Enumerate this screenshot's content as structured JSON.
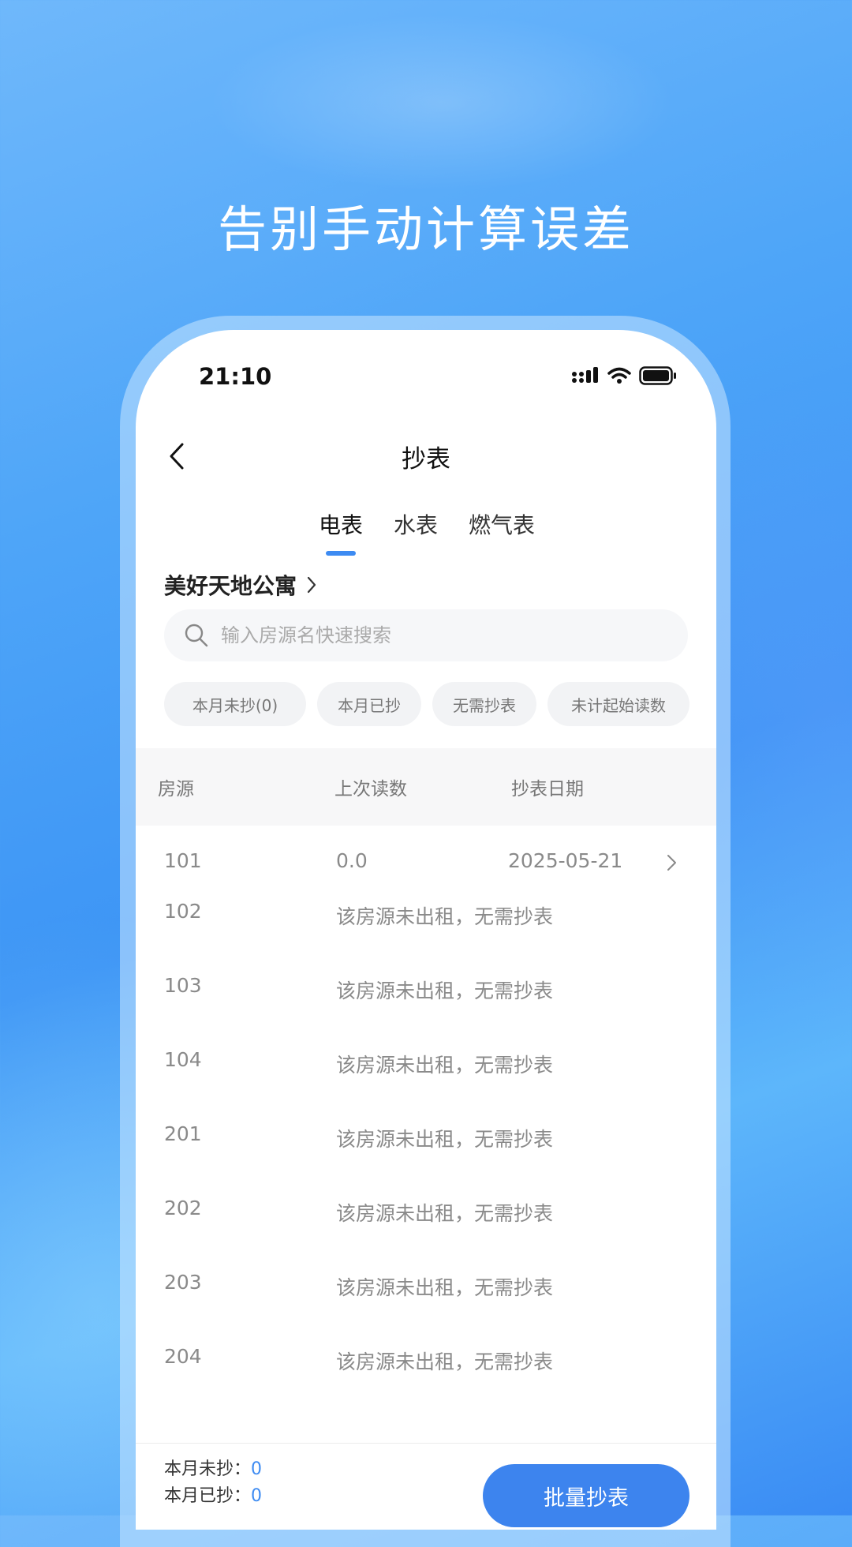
{
  "headline": "告别手动计算误差",
  "status_bar": {
    "time": "21:10"
  },
  "nav": {
    "title": "抄表"
  },
  "tabs": [
    {
      "label": "电表",
      "active": true
    },
    {
      "label": "水表",
      "active": false
    },
    {
      "label": "燃气表",
      "active": false
    }
  ],
  "property": {
    "name": "美好天地公寓"
  },
  "search": {
    "placeholder": "输入房源名快速搜索",
    "value": ""
  },
  "filters": [
    {
      "label": "本月未抄(0)"
    },
    {
      "label": "本月已抄"
    },
    {
      "label": "无需抄表"
    },
    {
      "label": "未计起始读数"
    }
  ],
  "table": {
    "headers": [
      "房源",
      "上次读数",
      "抄表日期"
    ],
    "rows": [
      {
        "room": "101",
        "last_reading": "0.0",
        "date": "2025-05-21"
      },
      {
        "room": "102",
        "note": "该房源未出租，无需抄表"
      },
      {
        "room": "103",
        "note": "该房源未出租，无需抄表"
      },
      {
        "room": "104",
        "note": "该房源未出租，无需抄表"
      },
      {
        "room": "201",
        "note": "该房源未出租，无需抄表"
      },
      {
        "room": "202",
        "note": "该房源未出租，无需抄表"
      },
      {
        "room": "203",
        "note": "该房源未出租，无需抄表"
      },
      {
        "room": "204",
        "note": "该房源未出租，无需抄表"
      }
    ]
  },
  "footer": {
    "unread_label": "本月未抄：",
    "unread_count": "0",
    "read_label": "本月已抄：",
    "read_count": "0",
    "batch_button": "批量抄表"
  },
  "colors": {
    "accent": "#3d8bf2",
    "button": "#3d84ee"
  }
}
